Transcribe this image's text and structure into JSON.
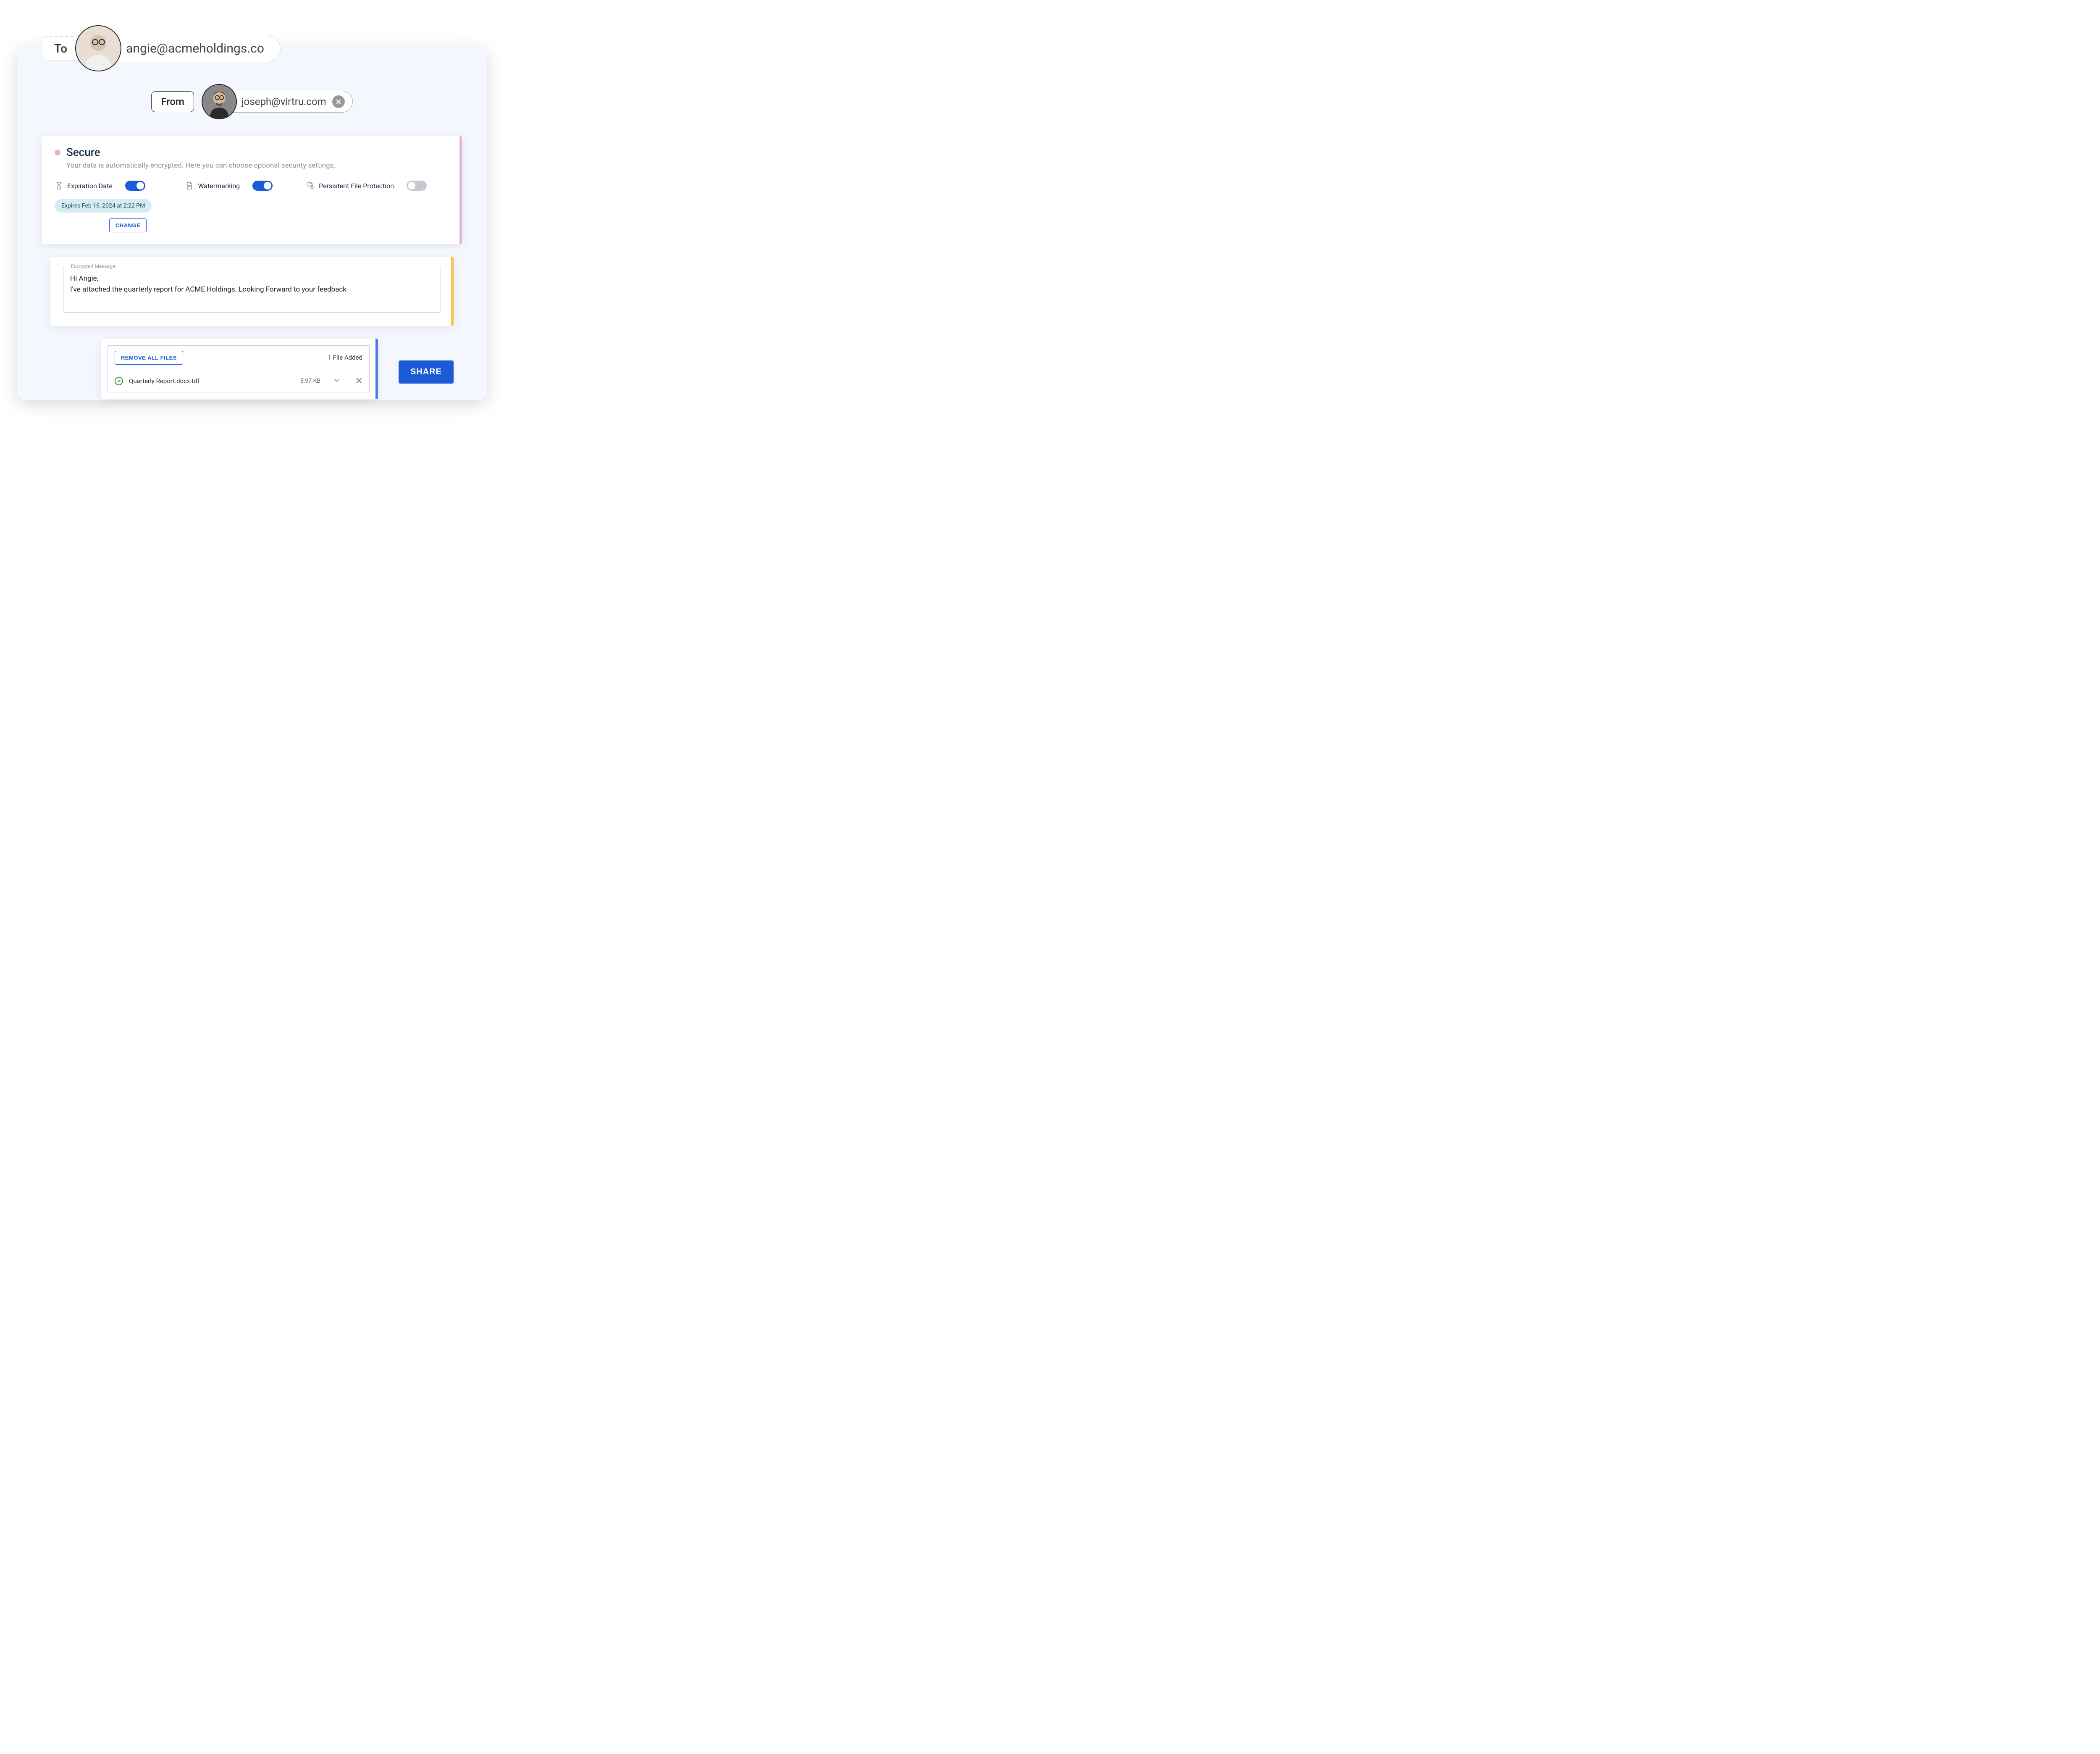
{
  "to": {
    "label": "To",
    "email": "angie@acmeholdings.co"
  },
  "from": {
    "label": "From",
    "email": "joseph@virtru.com"
  },
  "secure": {
    "title": "Secure",
    "description": "Your data is automatically encrypted. Here you can choose optional security settings.",
    "options": {
      "expiration": {
        "label": "Expiration Date",
        "enabled": true,
        "expires_text": "Expires Feb 16, 2024 at 2:22 PM",
        "change_label": "CHANGE"
      },
      "watermarking": {
        "label": "Watermarking",
        "enabled": true
      },
      "persistent": {
        "label": "Persistent File Protection",
        "enabled": false
      }
    }
  },
  "message": {
    "legend": "Encrypted Message",
    "body": "Hi Angie,\nI've attached the quarterly report for ACME Holdings. Looking Forward to your feedback"
  },
  "files": {
    "remove_all_label": "REMOVE ALL FILES",
    "count_label": "1 File Added",
    "items": [
      {
        "name": "Quarterly Report.docx.tdf",
        "size": "5.97 KB"
      }
    ]
  },
  "share_label": "SHARE"
}
